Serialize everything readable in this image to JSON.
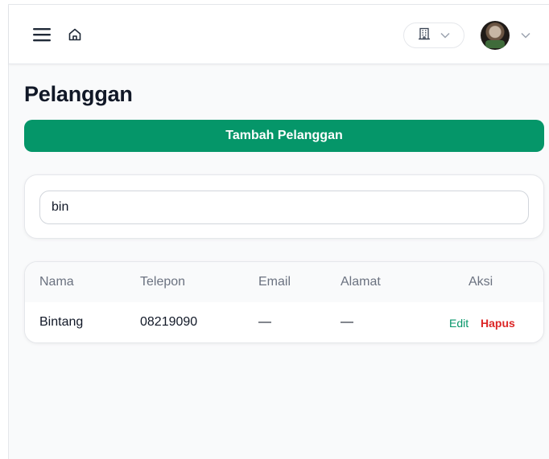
{
  "header": {
    "menu_icon": "hamburger-menu-icon",
    "home_icon": "home-icon",
    "org_icon": "building-icon",
    "chevron_icon": "chevron-down-icon",
    "avatar_icon": "user-avatar"
  },
  "page": {
    "title": "Pelanggan",
    "add_button_label": "Tambah Pelanggan"
  },
  "search": {
    "value": "bin"
  },
  "table": {
    "columns": [
      "Nama",
      "Telepon",
      "Email",
      "Alamat",
      "Aksi"
    ],
    "rows": [
      {
        "nama": "Bintang",
        "telepon": "08219090",
        "email": "—",
        "alamat": "—",
        "edit_label": "Edit",
        "delete_label": "Hapus"
      }
    ]
  },
  "colors": {
    "primary": "#059669",
    "danger": "#dc2626",
    "muted_text": "#6b7280",
    "background": "#f9fafb"
  }
}
